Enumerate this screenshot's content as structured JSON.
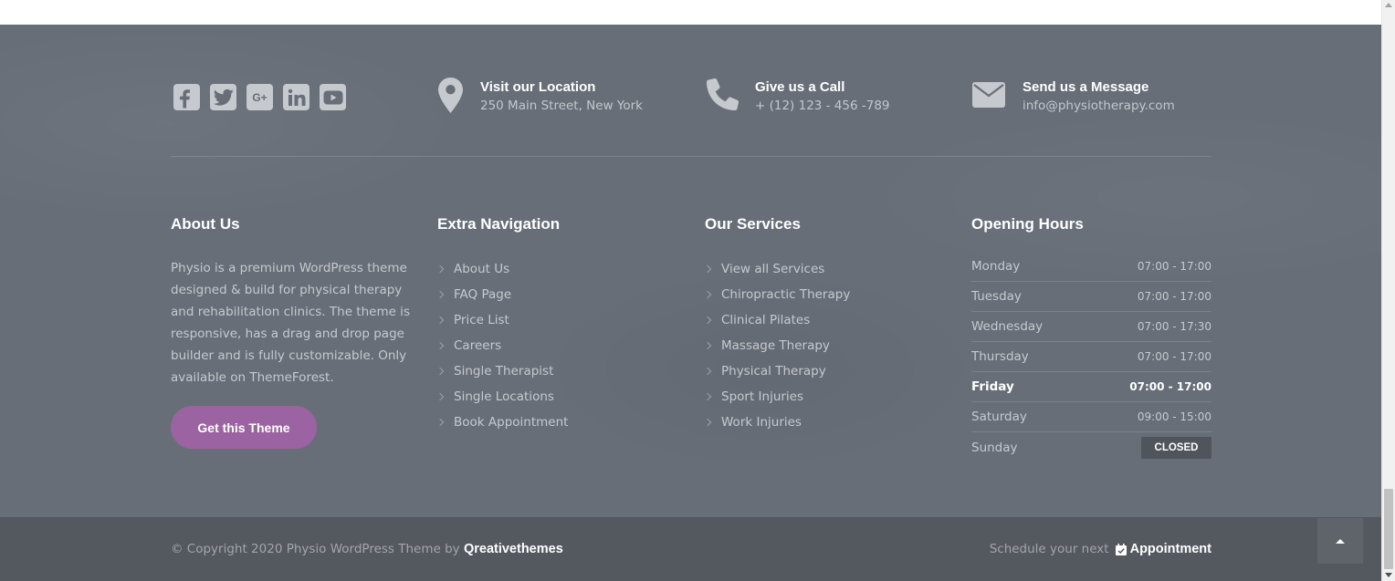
{
  "colors": {
    "footer_bg": "#676e78",
    "footer_bottom_bg": "#54585f",
    "accent_button": "#9c63a2",
    "icon_light": "#c6c9cd"
  },
  "social": [
    {
      "name": "facebook",
      "icon": "facebook-icon"
    },
    {
      "name": "twitter",
      "icon": "twitter-icon"
    },
    {
      "name": "google-plus",
      "icon": "google-plus-icon",
      "glyph": "G+"
    },
    {
      "name": "linkedin",
      "icon": "linkedin-icon"
    },
    {
      "name": "youtube",
      "icon": "youtube-icon"
    }
  ],
  "contact": {
    "location": {
      "icon": "map-pin-icon",
      "title": "Visit our Location",
      "text": "250 Main Street, New York"
    },
    "call": {
      "icon": "phone-icon",
      "title": "Give us a Call",
      "text": "+ (12) 123 - 456 -789"
    },
    "message": {
      "icon": "envelope-icon",
      "title": "Send us a Message",
      "text": "info@physiotherapy.com"
    }
  },
  "about": {
    "title": "About Us",
    "text": "Physio is a premium WordPress theme designed & build for physical therapy and rehabilitation clinics. The theme is responsive, has a drag and drop page builder and is fully customizable. Only available on ThemeForest.",
    "button": "Get this Theme"
  },
  "extra_nav": {
    "title": "Extra Navigation",
    "items": [
      "About Us",
      "FAQ Page",
      "Price List",
      "Careers",
      "Single Therapist",
      "Single Locations",
      "Book Appointment"
    ]
  },
  "services": {
    "title": "Our Services",
    "items": [
      "View all Services",
      "Chiropractic Therapy",
      "Clinical Pilates",
      "Massage Therapy",
      "Physical Therapy",
      "Sport Injuries",
      "Work Injuries"
    ]
  },
  "hours": {
    "title": "Opening Hours",
    "rows": [
      {
        "day": "Monday",
        "time": "07:00 - 17:00"
      },
      {
        "day": "Tuesday",
        "time": "07:00 - 17:00"
      },
      {
        "day": "Wednesday",
        "time": "07:00 - 17:30"
      },
      {
        "day": "Thursday",
        "time": "07:00 - 17:00"
      },
      {
        "day": "Friday",
        "time": "07:00 - 17:00",
        "today": true
      },
      {
        "day": "Saturday",
        "time": "09:00 - 15:00"
      },
      {
        "day": "Sunday",
        "time": "CLOSED",
        "closed": true
      }
    ]
  },
  "bottom": {
    "copyright_prefix": "© Copyright 2020 Physio WordPress Theme by",
    "brand": "Qreativethemes",
    "schedule_prefix": "Schedule your next",
    "schedule_link": "Appointment",
    "calendar_icon": "calendar-check-icon",
    "back_to_top_icon": "caret-up-icon"
  }
}
